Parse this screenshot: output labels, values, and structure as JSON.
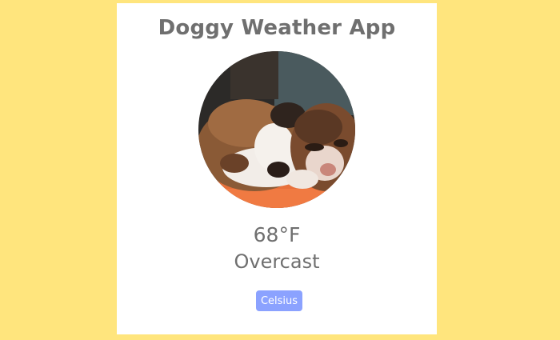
{
  "app": {
    "title": "Doggy Weather App"
  },
  "weather": {
    "temperature": "68°F",
    "condition": "Overcast"
  },
  "controls": {
    "unit_toggle_label": "Celsius"
  },
  "colors": {
    "page_background": "#ffe57d",
    "card_background": "#ffffff",
    "text": "#6f6f6f",
    "button": "#8ba2ff"
  }
}
